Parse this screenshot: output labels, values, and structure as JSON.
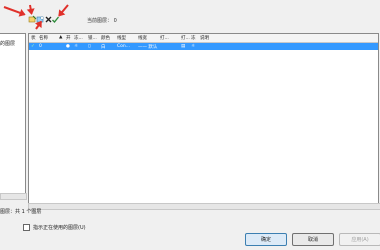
{
  "toolbar": {
    "new_layer_icon": "new-layer-icon",
    "new_vp_layer_icon": "new-vp-frozen-layer-icon",
    "delete_layer_icon": "delete-layer-icon",
    "set_current_icon": "set-current-icon",
    "current_layer_label": "当前图层： 0"
  },
  "left_panel": {
    "tree_item": "的图层"
  },
  "table": {
    "headers": [
      "状",
      "名称",
      "▲",
      "开",
      "冻...",
      "锁...",
      "颜色",
      "线型",
      "线宽",
      "打...",
      "打...",
      "冻",
      "说明"
    ],
    "row": {
      "status": "✓",
      "name": "0",
      "color": "白",
      "linetype": "Con...",
      "lineweight": "—— 默认"
    }
  },
  "summary": {
    "text": "图层：共 1 个图层"
  },
  "options": {
    "show_in_use": "指示正在使用的图层(U)"
  },
  "buttons": {
    "ok": "确定",
    "cancel": "取消",
    "apply": "应用(A)"
  },
  "colors": {
    "selected": "#3399ff",
    "annotation": "#e0302a"
  }
}
